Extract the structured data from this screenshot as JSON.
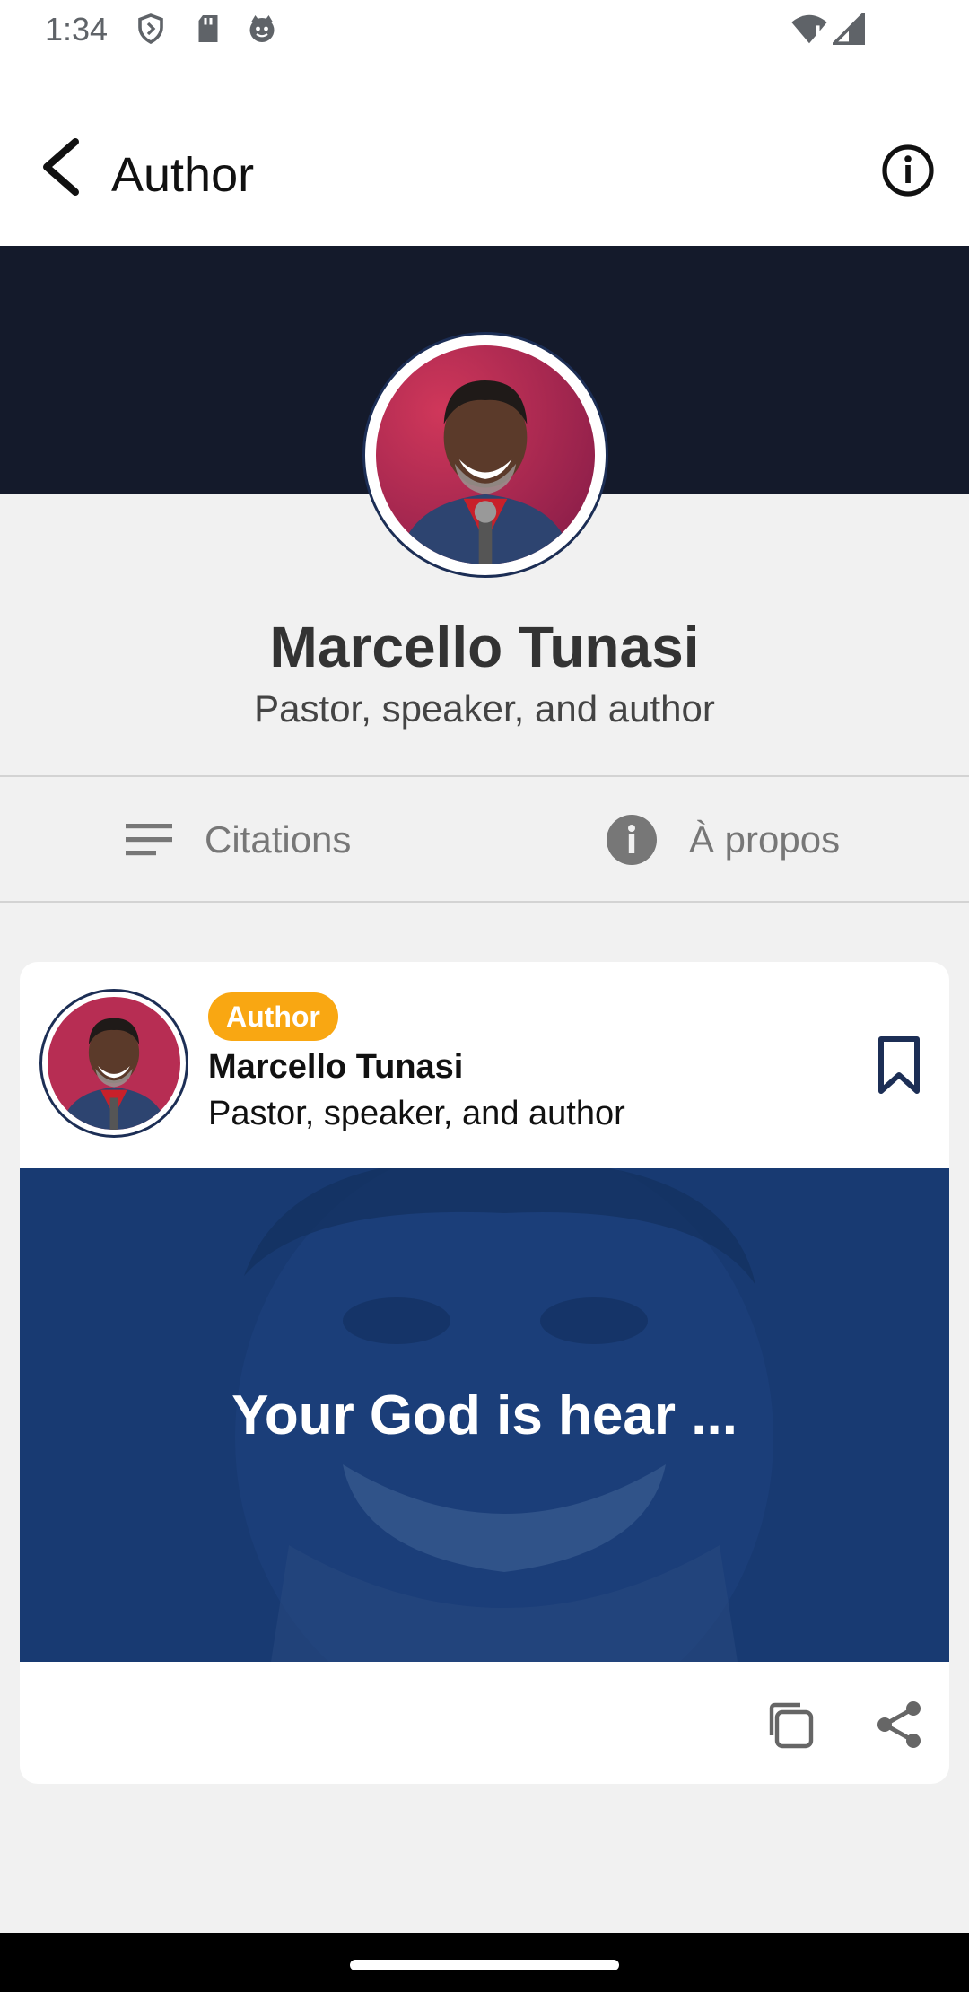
{
  "status_bar": {
    "time": "1:34",
    "icons": [
      "shield-icon",
      "sd-card-icon",
      "cat-face-icon",
      "wifi-alert-icon",
      "signal-icon"
    ]
  },
  "appbar": {
    "title": "Author",
    "back_icon": "arrow-back-icon",
    "info_icon": "info-outline-icon"
  },
  "profile": {
    "name": "Marcello Tunasi",
    "role": "Pastor, speaker, and author"
  },
  "tabs": [
    {
      "label": "Citations",
      "icon": "list-icon"
    },
    {
      "label": "À propos",
      "icon": "info-filled-icon"
    }
  ],
  "card": {
    "badge": "Author",
    "name": "Marcello Tunasi",
    "role": "Pastor, speaker, and author",
    "quote": "Your God is hear ...",
    "actions": [
      "copy-icon",
      "share-icon"
    ]
  },
  "colors": {
    "hero": "#141a2b",
    "badge": "#f9a712",
    "quote_overlay": "#183a72",
    "accent": "#1c2e55"
  }
}
